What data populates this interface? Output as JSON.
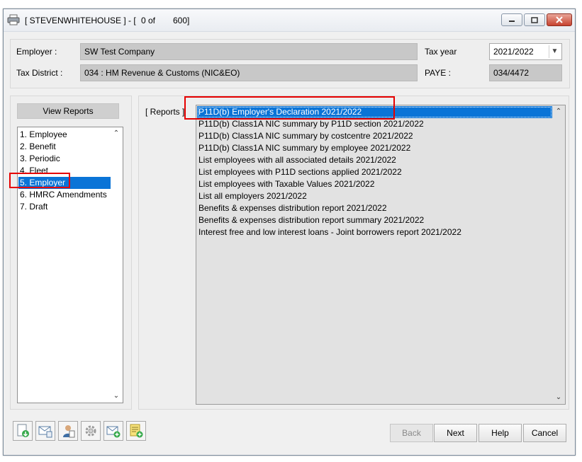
{
  "window": {
    "title": "[ STEVENWHITEHOUSE ] - [",
    "record_position": "0 of",
    "record_total": "600]"
  },
  "header": {
    "employer_label": "Employer :",
    "employer_value": "SW Test Company",
    "tax_district_label": "Tax District :",
    "tax_district_value": "034 : HM Revenue & Customs (NIC&EO)",
    "tax_year_label": "Tax year",
    "tax_year_value": "2021/2022",
    "paye_label": "PAYE :",
    "paye_value": "034/4472"
  },
  "left_panel": {
    "heading": "View Reports",
    "categories": [
      "1. Employee",
      "2. Benefit",
      "3. Periodic",
      "4. Fleet",
      "5. Employer",
      "6. HMRC Amendments",
      "7. Draft"
    ],
    "selected_index": 4
  },
  "right_panel": {
    "reports_label": "[ Reports ]",
    "reports": [
      "P11D(b) Employer's Declaration 2021/2022",
      "P11D(b) Class1A NIC summary by P11D section 2021/2022",
      "P11D(b) Class1A NIC summary by costcentre 2021/2022",
      "P11D(b) Class1A NIC summary by employee 2021/2022",
      "List employees with all associated details 2021/2022",
      "List employees with P11D sections applied 2021/2022",
      "List employees with Taxable Values 2021/2022",
      "List all employers 2021/2022",
      "Benefits & expenses distribution report 2021/2022",
      "Benefits & expenses distribution report summary 2021/2022",
      "Interest free and low interest loans - Joint borrowers report 2021/2022"
    ],
    "selected_index": 0
  },
  "footer": {
    "icons": [
      "import-icon",
      "email-icon",
      "user-icon",
      "gear-icon",
      "email-add-icon",
      "note-add-icon"
    ],
    "back_label": "Back",
    "next_label": "Next",
    "help_label": "Help",
    "cancel_label": "Cancel"
  },
  "colors": {
    "selection": "#0a74d7",
    "highlight_box": "#e60000",
    "field_bg": "#c8c8c8"
  }
}
